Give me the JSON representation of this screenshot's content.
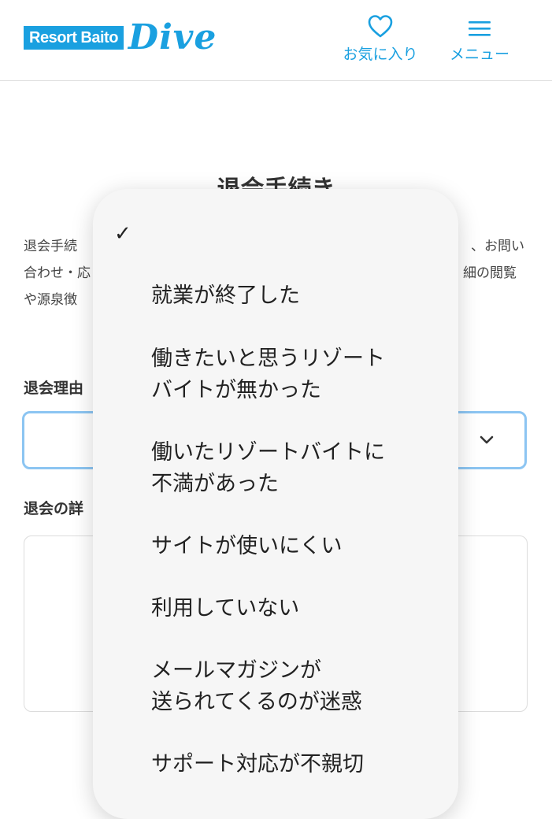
{
  "header": {
    "logo_box_text": "Resort Baito",
    "logo_script_text": "Dive",
    "favorites_label": "お気に入り",
    "menu_label": "メニュー",
    "accent_color": "#1aa0e0"
  },
  "page": {
    "title": "退会手続き",
    "intro_lines": [
      {
        "left": "退会手続",
        "right": "、お問い"
      },
      {
        "left": "合わせ・応",
        "right": "細の閲覧"
      },
      {
        "left": "や源泉徴",
        "right": ""
      }
    ],
    "reason_label": "退会理由",
    "detail_label": "退会の詳"
  },
  "dropdown": {
    "check_mark": "✓",
    "selected_index": 0,
    "options": [
      {
        "lines": [
          "就業が終了した"
        ]
      },
      {
        "lines": [
          "働きたいと思うリゾート",
          "バイトが無かった"
        ]
      },
      {
        "lines": [
          "働いたリゾートバイトに",
          "不満があった"
        ]
      },
      {
        "lines": [
          "サイトが使いにくい"
        ]
      },
      {
        "lines": [
          "利用していない"
        ]
      },
      {
        "lines": [
          "メールマガジンが",
          "送られてくるのが迷惑"
        ]
      },
      {
        "lines": [
          "サポート対応が不親切"
        ]
      }
    ]
  },
  "icons": {
    "favorites": "heart-icon",
    "menu": "hamburger-icon",
    "select": "chevron-down-icon",
    "selected": "checkmark-icon"
  }
}
